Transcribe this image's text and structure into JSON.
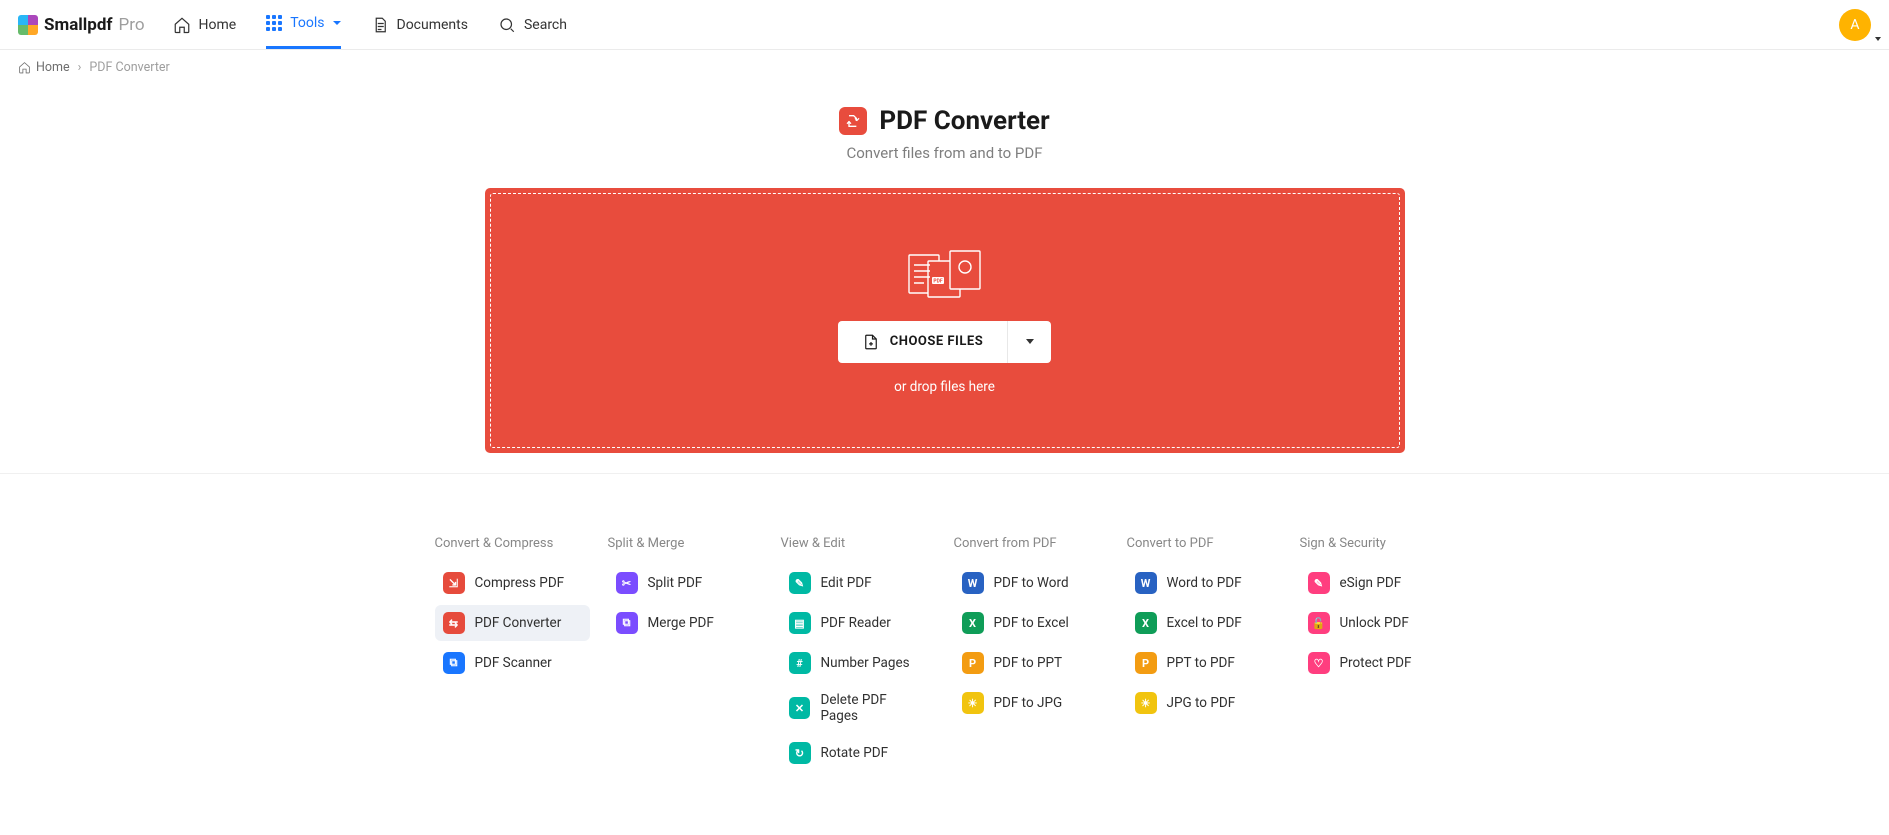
{
  "brand": {
    "name": "Smallpdf",
    "plan": "Pro"
  },
  "nav": {
    "home": "Home",
    "tools": "Tools",
    "documents": "Documents",
    "search": "Search"
  },
  "breadcrumb": {
    "home": "Home",
    "sep": "›",
    "current": "PDF Converter"
  },
  "hero": {
    "title": "PDF Converter",
    "subtitle": "Convert files from and to PDF",
    "choose": "CHOOSE FILES",
    "hint": "or drop files here"
  },
  "cols": [
    {
      "title": "Convert & Compress",
      "items": [
        {
          "label": "Compress PDF",
          "cls": "t-red",
          "glyph": "⇲",
          "sel": false
        },
        {
          "label": "PDF Converter",
          "cls": "t-red",
          "glyph": "⇆",
          "sel": true
        },
        {
          "label": "PDF Scanner",
          "cls": "t-blue",
          "glyph": "⧉",
          "sel": false
        }
      ]
    },
    {
      "title": "Split & Merge",
      "items": [
        {
          "label": "Split PDF",
          "cls": "t-purple",
          "glyph": "✂",
          "sel": false
        },
        {
          "label": "Merge PDF",
          "cls": "t-purple",
          "glyph": "⧉",
          "sel": false
        }
      ]
    },
    {
      "title": "View & Edit",
      "items": [
        {
          "label": "Edit PDF",
          "cls": "t-teal",
          "glyph": "✎",
          "sel": false
        },
        {
          "label": "PDF Reader",
          "cls": "t-teal",
          "glyph": "▤",
          "sel": false
        },
        {
          "label": "Number Pages",
          "cls": "t-teal",
          "glyph": "#",
          "sel": false
        },
        {
          "label": "Delete PDF Pages",
          "cls": "t-teal",
          "glyph": "✕",
          "sel": false
        },
        {
          "label": "Rotate PDF",
          "cls": "t-teal",
          "glyph": "↻",
          "sel": false
        }
      ]
    },
    {
      "title": "Convert from PDF",
      "items": [
        {
          "label": "PDF to Word",
          "cls": "t-navy",
          "glyph": "W",
          "sel": false
        },
        {
          "label": "PDF to Excel",
          "cls": "t-green",
          "glyph": "X",
          "sel": false
        },
        {
          "label": "PDF to PPT",
          "cls": "t-orange",
          "glyph": "P",
          "sel": false
        },
        {
          "label": "PDF to JPG",
          "cls": "t-yellow",
          "glyph": "☀",
          "sel": false
        }
      ]
    },
    {
      "title": "Convert to PDF",
      "items": [
        {
          "label": "Word to PDF",
          "cls": "t-navy",
          "glyph": "W",
          "sel": false
        },
        {
          "label": "Excel to PDF",
          "cls": "t-green",
          "glyph": "X",
          "sel": false
        },
        {
          "label": "PPT to PDF",
          "cls": "t-orange",
          "glyph": "P",
          "sel": false
        },
        {
          "label": "JPG to PDF",
          "cls": "t-yellow",
          "glyph": "☀",
          "sel": false
        }
      ]
    },
    {
      "title": "Sign & Security",
      "items": [
        {
          "label": "eSign PDF",
          "cls": "t-pink",
          "glyph": "✎",
          "sel": false
        },
        {
          "label": "Unlock PDF",
          "cls": "t-lock",
          "glyph": "🔓",
          "sel": false
        },
        {
          "label": "Protect PDF",
          "cls": "t-lock",
          "glyph": "♡",
          "sel": false
        }
      ]
    }
  ],
  "avatar": "A"
}
